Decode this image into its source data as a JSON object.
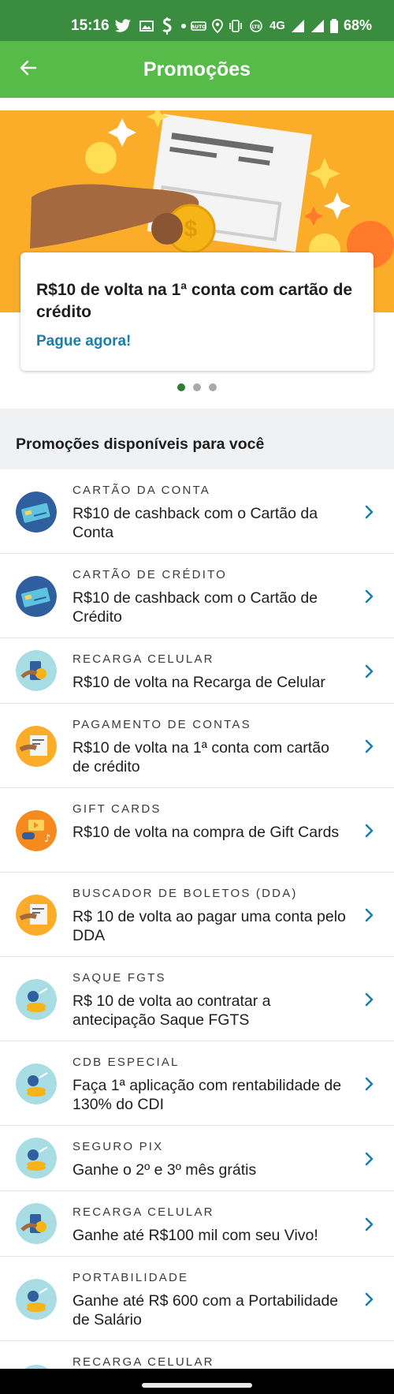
{
  "status_bar": {
    "time": "15:16",
    "network": "4G",
    "battery": "68%"
  },
  "app_bar": {
    "title": "Promoções"
  },
  "banner": {
    "card_title": "R$10 de volta na 1ª conta com cartão de crédito",
    "card_link": "Pague agora!",
    "slide_count": 3,
    "active_slide": 1
  },
  "section": {
    "title": "Promoções disponíveis para você"
  },
  "promotions": [
    {
      "category": "CARTÃO DA CONTA",
      "description": "R$10 de cashback com o Cartão da Conta",
      "icon": "card-icon"
    },
    {
      "category": "CARTÃO DE CRÉDITO",
      "description": "R$10 de cashback com o Cartão de Crédito",
      "icon": "card-icon"
    },
    {
      "category": "RECARGA CELULAR",
      "description": "R$10 de volta na Recarga de Celular",
      "icon": "phone-recharge-icon"
    },
    {
      "category": "PAGAMENTO DE CONTAS",
      "description": "R$10 de volta na 1ª conta com cartão de crédito",
      "icon": "bill-payment-icon"
    },
    {
      "category": "GIFT CARDS",
      "description": "R$10 de volta na compra de Gift Cards",
      "icon": "gift-card-icon"
    },
    {
      "category": "BUSCADOR DE BOLETOS (DDA)",
      "description": "R$ 10 de volta ao pagar uma conta pelo DDA",
      "icon": "bill-payment-icon"
    },
    {
      "category": "SAQUE FGTS",
      "description": "R$ 10 de volta ao contratar a antecipação Saque FGTS",
      "icon": "money-growth-icon"
    },
    {
      "category": "CDB ESPECIAL",
      "description": "Faça 1ª aplicação com rentabilidade de 130% do CDI",
      "icon": "money-growth-icon"
    },
    {
      "category": "SEGURO PIX",
      "description": "Ganhe o 2º e 3º mês grátis",
      "icon": "money-growth-icon"
    },
    {
      "category": "RECARGA CELULAR",
      "description": "Ganhe até R$100 mil com seu Vivo!",
      "icon": "phone-recharge-icon"
    },
    {
      "category": "PORTABILIDADE",
      "description": "Ganhe até R$ 600 com a Portabilidade de Salário",
      "icon": "money-growth-icon"
    },
    {
      "category": "RECARGA CELULAR",
      "description": "",
      "icon": "phone-recharge-icon"
    }
  ],
  "colors": {
    "status_bar": "#3a8c3f",
    "app_bar": "#57bb4a",
    "banner": "#fbac28",
    "link": "#1b7ea8",
    "chevron": "#1b7ea8",
    "section_bg": "#f0f1f3"
  }
}
